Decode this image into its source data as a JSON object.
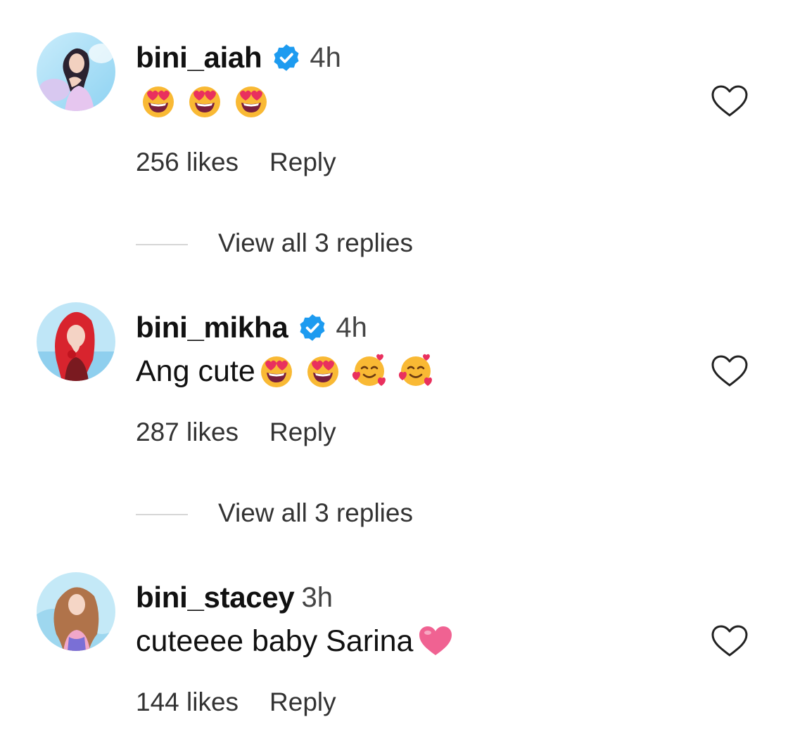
{
  "colors": {
    "verified": "#1d9bf0",
    "text": "#111111",
    "muted": "#444444",
    "heart_emoji": "#f06292"
  },
  "comments": [
    {
      "username": "bini_aiah",
      "verified": true,
      "time": "4h",
      "text": "",
      "emojis": [
        "heart-eyes-emoji",
        "heart-eyes-emoji",
        "heart-eyes-emoji"
      ],
      "likes": "256 likes",
      "reply_label": "Reply",
      "view_replies": "View all 3 replies"
    },
    {
      "username": "bini_mikha",
      "verified": true,
      "time": "4h",
      "text": "Ang cute",
      "emojis": [
        "heart-eyes-emoji",
        "heart-eyes-emoji",
        "smiling-face-with-hearts-emoji",
        "smiling-face-with-hearts-emoji"
      ],
      "likes": "287 likes",
      "reply_label": "Reply",
      "view_replies": "View all 3 replies"
    },
    {
      "username": "bini_stacey",
      "verified": false,
      "time": "3h",
      "text": "cuteeee baby Sarina",
      "emojis": [
        "pink-heart-emoji"
      ],
      "likes": "144 likes",
      "reply_label": "Reply"
    }
  ]
}
